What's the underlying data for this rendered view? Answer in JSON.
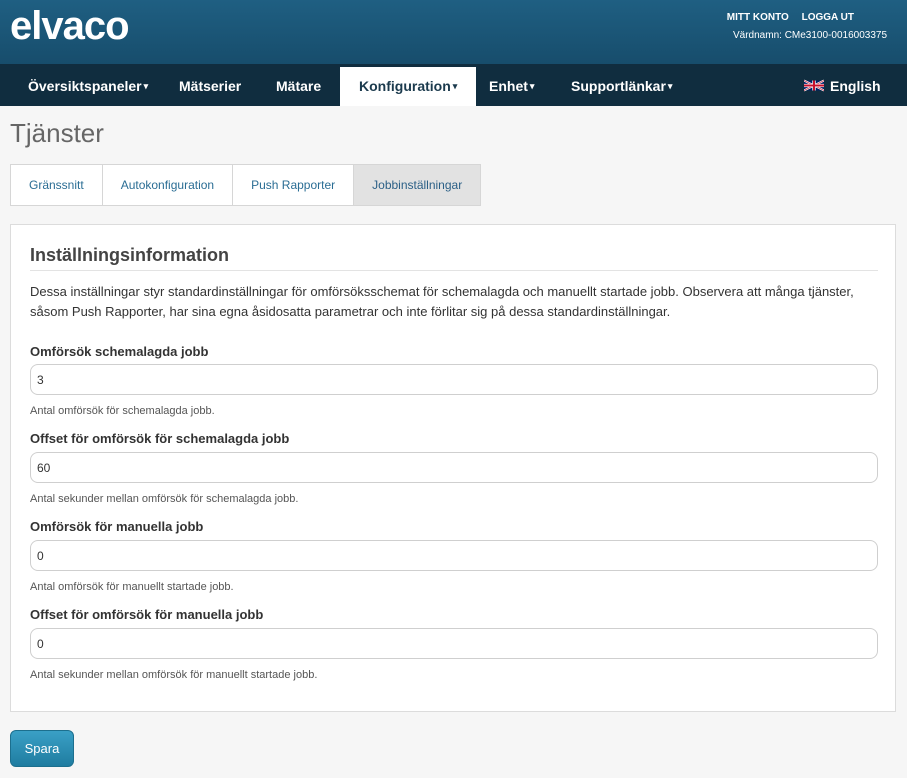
{
  "brand": {
    "logo_text": "elvaco"
  },
  "header": {
    "account_label": "MITT KONTO",
    "logout_label": "LOGGA UT",
    "hostname": "Värdnamn: CMe3100-0016003375"
  },
  "nav": {
    "items": [
      {
        "label": "Översiktspaneler",
        "has_caret": true
      },
      {
        "label": "Mätserier",
        "has_caret": false
      },
      {
        "label": "Mätare",
        "has_caret": false
      },
      {
        "label": "Konfiguration",
        "has_caret": true,
        "active": true
      },
      {
        "label": "Enhet",
        "has_caret": true
      },
      {
        "label": "Supportlänkar",
        "has_caret": true
      }
    ],
    "language_label": "English",
    "caret": "▾"
  },
  "page": {
    "title": "Tjänster"
  },
  "tabs": [
    {
      "label": "Gränssnitt"
    },
    {
      "label": "Autokonfiguration"
    },
    {
      "label": "Push Rapporter"
    },
    {
      "label": "Jobbinställningar",
      "active": true
    }
  ],
  "panel": {
    "heading": "Inställningsinformation",
    "description": "Dessa inställningar styr standardinställningar för omförsöksschemat för schemalagda och manuellt startade jobb. Observera att många tjänster, såsom Push Rapporter, har sina egna åsidosatta parametrar och inte förlitar sig på dessa standardinställningar.",
    "fields": [
      {
        "label": "Omförsök schemalagda jobb",
        "value": "3",
        "help": "Antal omförsök för schemalagda jobb."
      },
      {
        "label": "Offset för omförsök för schemalagda jobb",
        "value": "60",
        "help": "Antal sekunder mellan omförsök för schemalagda jobb."
      },
      {
        "label": "Omförsök för manuella jobb",
        "value": "0",
        "help": "Antal omförsök för manuellt startade jobb."
      },
      {
        "label": "Offset för omförsök för manuella jobb",
        "value": "0",
        "help": "Antal sekunder mellan omförsök för manuellt startade jobb."
      }
    ]
  },
  "actions": {
    "save_label": "Spara"
  },
  "colors": {
    "header_bg": "#1f5f82",
    "nav_bg": "#102d3f",
    "link": "#2a6d94",
    "button": "#2a8db3"
  }
}
